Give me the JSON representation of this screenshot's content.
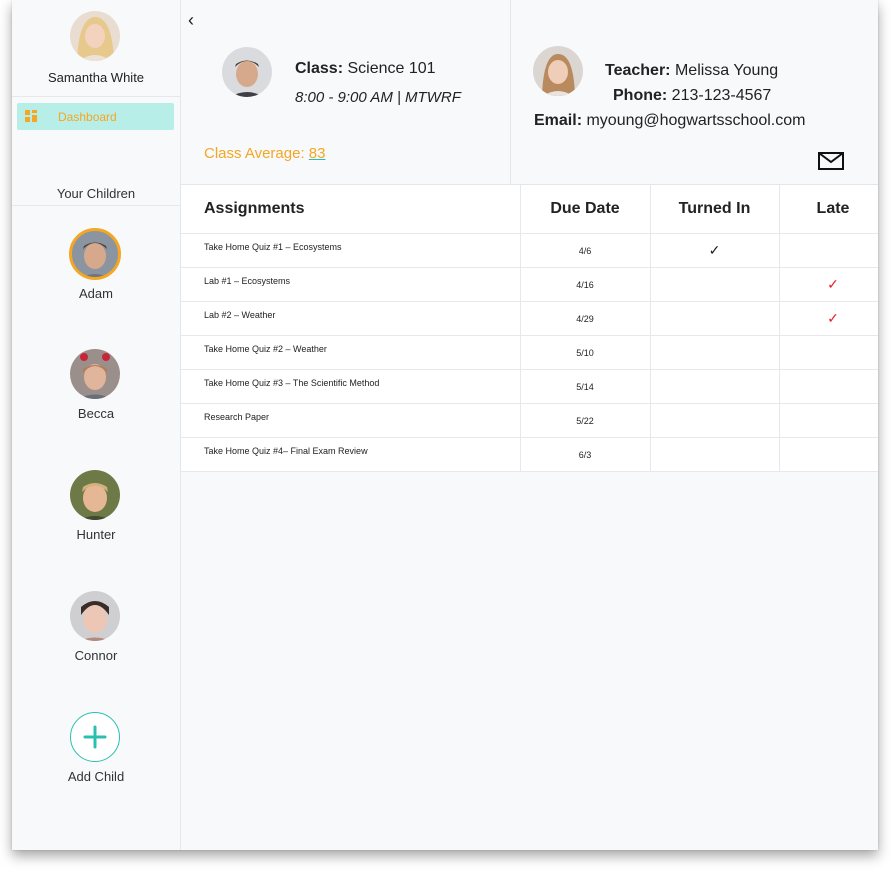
{
  "sidebar": {
    "parent_name": "Samantha White",
    "nav": {
      "dashboard_label": "Dashboard"
    },
    "children_heading": "Your Children",
    "children": [
      {
        "name": "Adam",
        "selected": true
      },
      {
        "name": "Becca",
        "selected": false
      },
      {
        "name": "Hunter",
        "selected": false
      },
      {
        "name": "Connor",
        "selected": false
      }
    ],
    "add_child_label": "Add Child"
  },
  "class_info": {
    "class_label": "Class:",
    "class_name": "Science 101",
    "schedule": "8:00 - 9:00 AM | MTWRF",
    "average_label": "Class Average:",
    "average_value": "83"
  },
  "teacher": {
    "teacher_label": "Teacher:",
    "name": "Melissa Young",
    "phone_label": "Phone:",
    "phone": "213-123-4567",
    "email_label": "Email:",
    "email": "myoung@hogwartsschool.com"
  },
  "table": {
    "headers": {
      "assignments": "Assignments",
      "due_date": "Due Date",
      "turned_in": "Turned In",
      "late": "Late"
    },
    "rows": [
      {
        "assignment": "Take Home Quiz #1 – Ecosystems",
        "due": "4/6",
        "turned_in": true,
        "late": false
      },
      {
        "assignment": "Lab #1 – Ecosystems",
        "due": "4/16",
        "turned_in": false,
        "late": true
      },
      {
        "assignment": "Lab #2 – Weather",
        "due": "4/29",
        "turned_in": false,
        "late": true
      },
      {
        "assignment": "Take Home Quiz #2 – Weather",
        "due": "5/10",
        "turned_in": false,
        "late": false
      },
      {
        "assignment": "Take Home Quiz #3 – The Scientific Method",
        "due": "5/14",
        "turned_in": false,
        "late": false
      },
      {
        "assignment": "Research Paper",
        "due": "5/22",
        "turned_in": false,
        "late": false
      },
      {
        "assignment": "Take Home Quiz #4– Final Exam Review",
        "due": "6/3",
        "turned_in": false,
        "late": false
      }
    ],
    "check_glyph": "✓"
  },
  "icons": {
    "back": "chevron-left-icon",
    "dashboard": "grid-icon",
    "mail": "mail-icon",
    "add": "plus-icon"
  },
  "colors": {
    "accent_orange": "#f5a623",
    "accent_teal": "#2bbfb0",
    "late_red": "#e8202a",
    "nav_highlight": "#b8eee8"
  }
}
